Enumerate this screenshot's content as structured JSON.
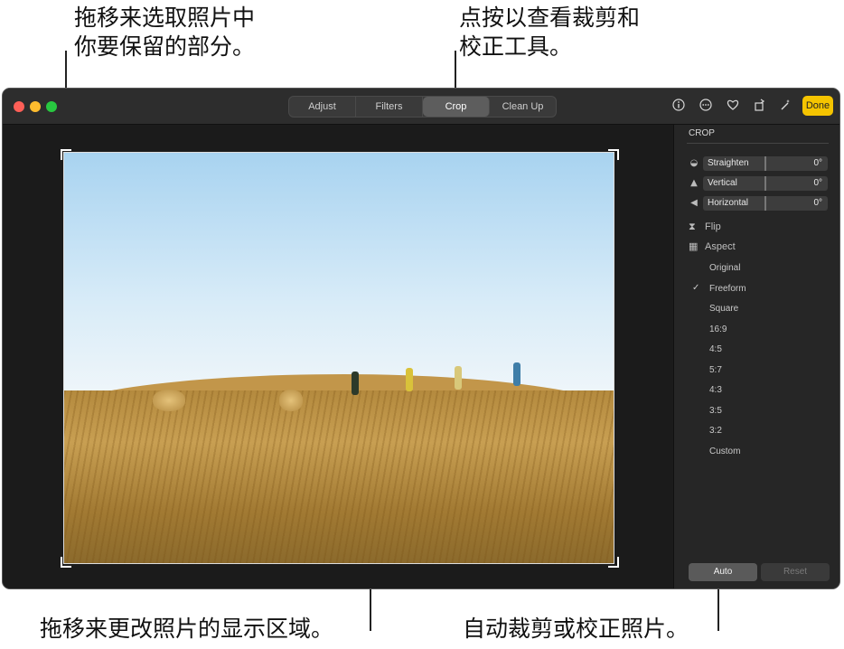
{
  "callouts": {
    "top_left": "拖移来选取照片中\n你要保留的部分。",
    "top_right": "点按以查看裁剪和\n校正工具。",
    "bottom_left": "拖移来更改照片的显示区域。",
    "bottom_right": "自动裁剪或校正照片。"
  },
  "toolbar": {
    "tabs": [
      "Adjust",
      "Filters",
      "Crop",
      "Clean Up"
    ],
    "active_tab": "Crop",
    "done_label": "Done",
    "icons": [
      "info-icon",
      "more-icon",
      "heart-icon",
      "rotate-icon",
      "magic-wand-icon"
    ]
  },
  "panel": {
    "title": "CROP",
    "sliders": [
      {
        "label": "Straighten",
        "value": "0°"
      },
      {
        "label": "Vertical",
        "value": "0°"
      },
      {
        "label": "Horizontal",
        "value": "0°"
      }
    ],
    "flip_label": "Flip",
    "aspect_label": "Aspect",
    "aspect_options": [
      "Original",
      "Freeform",
      "Square",
      "16:9",
      "4:5",
      "5:7",
      "4:3",
      "3:5",
      "3:2",
      "Custom"
    ],
    "selected_aspect": "Freeform",
    "auto_label": "Auto",
    "reset_label": "Reset"
  },
  "colors": {
    "accent_done": "#f5c400",
    "traffic_red": "#fe5f57",
    "traffic_yellow": "#febc2e",
    "traffic_green": "#28c840"
  }
}
